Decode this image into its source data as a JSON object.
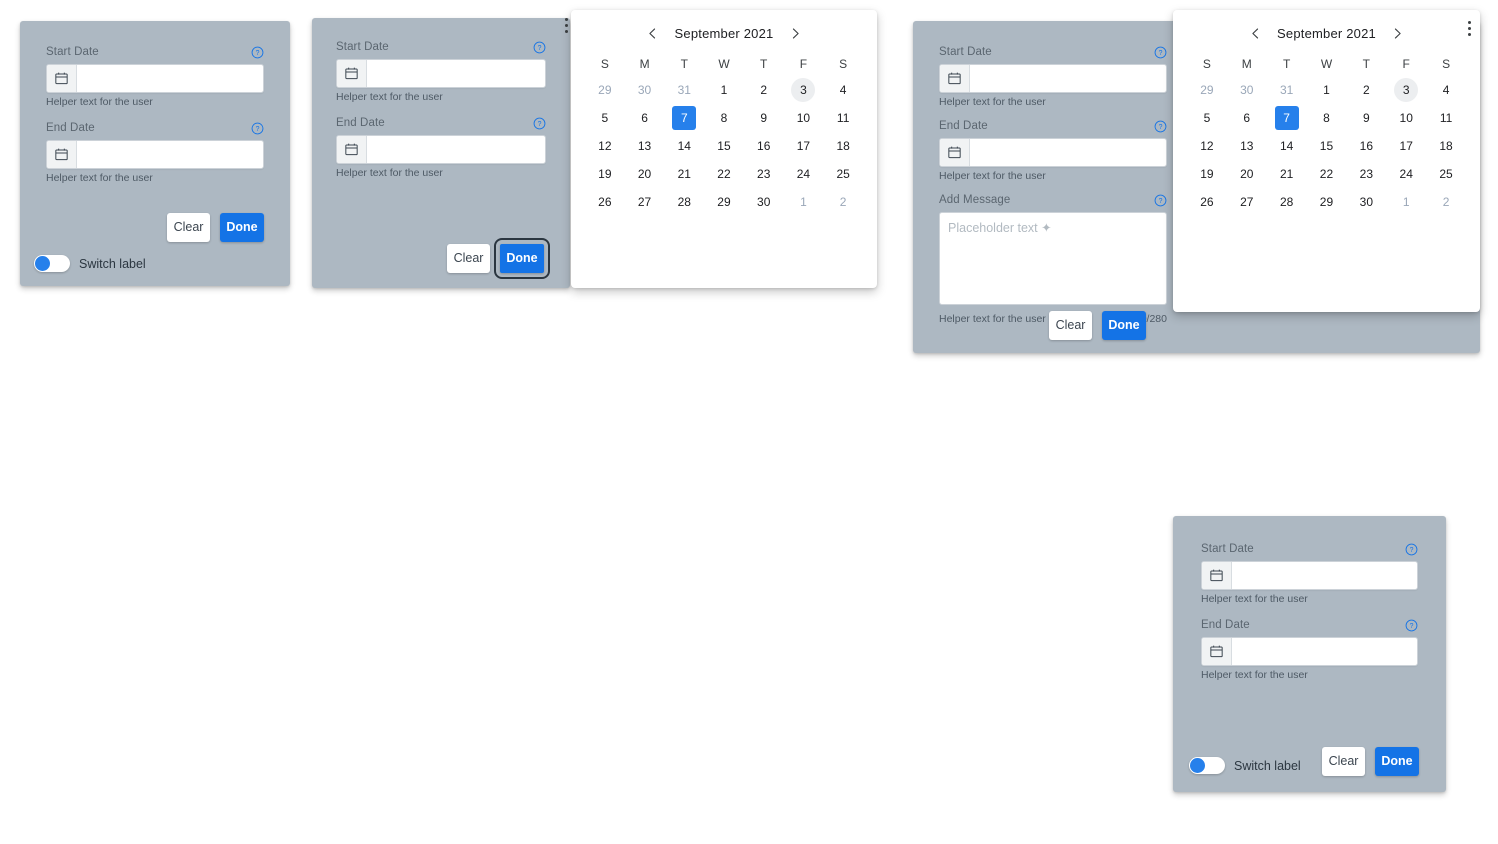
{
  "common": {
    "start_date_label": "Start Date",
    "end_date_label": "End Date",
    "add_message_label": "Add Message",
    "helper_text": "Helper text for the user",
    "date_value": "",
    "date_placeholder": "",
    "message_placeholder": "Placeholder text ✦",
    "message_value": "",
    "char_counter": "20/280",
    "clear_label": "Clear",
    "done_label": "Done",
    "switch_label": "Switch label",
    "help_icon": "help-circle-icon",
    "calendar_icon": "calendar-icon",
    "menu_icon": "more-vertical-icon",
    "colors": {
      "panel_bg": "#adb8c2",
      "accent_blue": "#1473e6",
      "toggle_blue": "#2680eb",
      "selected_blue": "#2680eb",
      "today_gray": "#eceef0",
      "muted_day": "#9aa7b8",
      "label_gray": "#5b6670",
      "field_white": "#ffffff",
      "icon_button_gray": "#f1f3f4",
      "focus_ring": "#2b3640"
    }
  },
  "calendar": {
    "month_title": "September 2021",
    "prev_label": "‹",
    "next_label": "›",
    "day_headers": [
      "S",
      "M",
      "T",
      "W",
      "T",
      "F",
      "S"
    ],
    "weeks": [
      [
        {
          "n": "29",
          "state": "muted"
        },
        {
          "n": "30",
          "state": "muted"
        },
        {
          "n": "31",
          "state": "muted"
        },
        {
          "n": "1",
          "state": "normal"
        },
        {
          "n": "2",
          "state": "normal"
        },
        {
          "n": "3",
          "state": "today"
        },
        {
          "n": "4",
          "state": "normal"
        }
      ],
      [
        {
          "n": "5",
          "state": "normal"
        },
        {
          "n": "6",
          "state": "normal"
        },
        {
          "n": "7",
          "state": "selected"
        },
        {
          "n": "8",
          "state": "normal"
        },
        {
          "n": "9",
          "state": "normal"
        },
        {
          "n": "10",
          "state": "normal"
        },
        {
          "n": "11",
          "state": "normal"
        }
      ],
      [
        {
          "n": "12",
          "state": "normal"
        },
        {
          "n": "13",
          "state": "normal"
        },
        {
          "n": "14",
          "state": "normal"
        },
        {
          "n": "15",
          "state": "normal"
        },
        {
          "n": "16",
          "state": "normal"
        },
        {
          "n": "17",
          "state": "normal"
        },
        {
          "n": "18",
          "state": "normal"
        }
      ],
      [
        {
          "n": "19",
          "state": "normal"
        },
        {
          "n": "20",
          "state": "normal"
        },
        {
          "n": "21",
          "state": "normal"
        },
        {
          "n": "22",
          "state": "normal"
        },
        {
          "n": "23",
          "state": "normal"
        },
        {
          "n": "24",
          "state": "normal"
        },
        {
          "n": "25",
          "state": "normal"
        }
      ],
      [
        {
          "n": "26",
          "state": "normal"
        },
        {
          "n": "27",
          "state": "normal"
        },
        {
          "n": "28",
          "state": "normal"
        },
        {
          "n": "29",
          "state": "normal"
        },
        {
          "n": "30",
          "state": "normal"
        },
        {
          "n": "1",
          "state": "muted"
        },
        {
          "n": "2",
          "state": "muted"
        }
      ]
    ]
  },
  "panels": {
    "panel1": {
      "name": "date-range-picker-with-switch"
    },
    "panel2": {
      "name": "date-range-picker-focused-done"
    },
    "panel3": {
      "name": "date-range-picker-with-message"
    },
    "panel4": {
      "name": "date-range-picker-with-switch-alt"
    }
  }
}
